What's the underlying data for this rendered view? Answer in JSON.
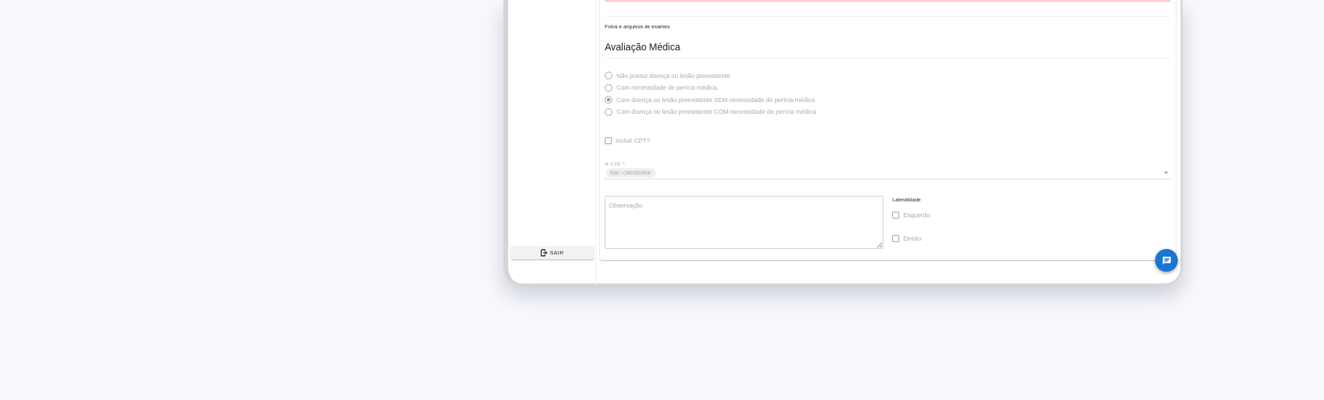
{
  "sidebar": {
    "logout_button": {
      "label": "SAIR"
    }
  },
  "form": {
    "attachments_label": "Fotos e arquivos de exames",
    "section_title": "Avaliação Médica",
    "disabled": true,
    "radios": [
      {
        "label": "Não possui doença ou lesão preexistente",
        "selected": false
      },
      {
        "label": "Com necessidade de perícia médica.",
        "selected": false
      },
      {
        "label": "Com doença ou lesão preexistente SEM necessidade de perícia médica",
        "selected": true
      },
      {
        "label": "Com doença ou lesão preexistente COM necessidade de perícia médica",
        "selected": false
      }
    ],
    "cpt_checkbox": {
      "label": "Incluir CPT?",
      "checked": false
    },
    "cid_field": {
      "label": "A CID *",
      "chips": [
        "E66 - OBESIDADE"
      ]
    },
    "observation": {
      "placeholder": "Observação"
    },
    "laterality": {
      "title": "Lateralidade",
      "options": [
        {
          "label": "Esquerdo",
          "checked": false
        },
        {
          "label": "Direito",
          "checked": false
        }
      ]
    }
  }
}
